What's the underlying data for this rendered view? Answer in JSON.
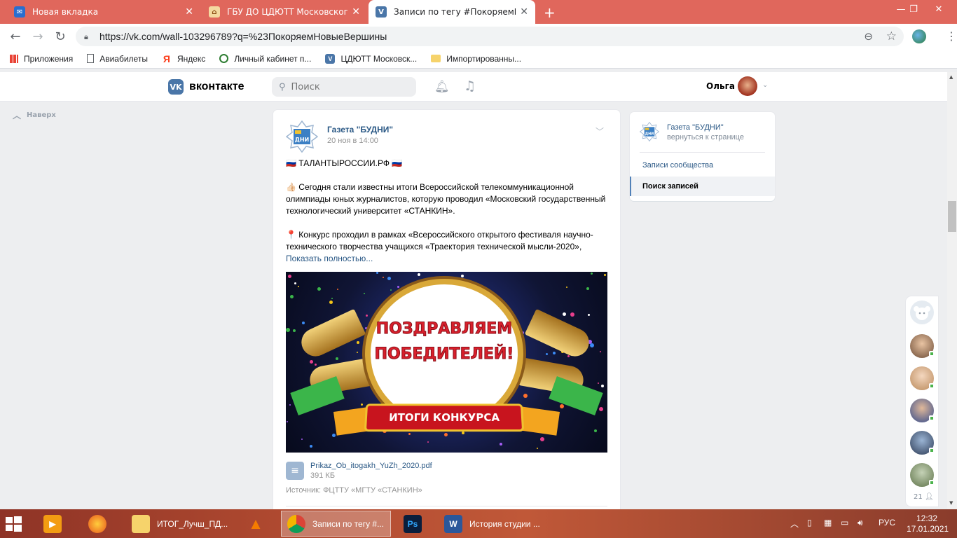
{
  "browser": {
    "tabs": [
      {
        "title": "Новая вкладка",
        "active": false
      },
      {
        "title": "ГБУ ДО ЦДЮТТ Московского р",
        "active": false
      },
      {
        "title": "Записи по тегу #ПокоряемНов",
        "active": true
      }
    ],
    "url": "https://vk.com/wall-103296789?q=%23ПокоряемНовыеВершины",
    "bookmarks": [
      {
        "label": "Приложения",
        "icon": "apps-grid-icon"
      },
      {
        "label": "Авиабилеты",
        "icon": "page-icon"
      },
      {
        "label": "Яндекс",
        "icon": "yandex-icon"
      },
      {
        "label": "Личный кабинет п...",
        "icon": "cabinet-icon"
      },
      {
        "label": "ЦДЮТТ Московск...",
        "icon": "vk-icon"
      },
      {
        "label": "Импортированны...",
        "icon": "folder-icon"
      }
    ]
  },
  "vk": {
    "logo_text": "вконтакте",
    "logo_letters": "VK",
    "search_placeholder": "Поиск",
    "user_name": "Ольга",
    "up_label": "Наверх"
  },
  "post": {
    "author": "Газета \"БУДНИ\"",
    "date": "20 ноя в 14:00",
    "paragraphs": [
      "🇷🇺 ТАЛАНТЫРОССИИ.РФ 🇷🇺",
      "👍🏻 Сегодня стали известны итоги Всероссийской телекоммуникационной олимпиады юных журналистов, которую проводил «Московский государственный технологический университет «СТАНКИН».",
      "📍 Конкурс проходил в рамках «Всероссийского открытого фестиваля научно-технического творчества учащихся «Траектория технической мысли-2020»,"
    ],
    "show_more": "Показать полностью...",
    "image_text_line1": "ПОЗДРАВЛЯЕМ",
    "image_text_line2": "ПОБЕДИТЕЛЕЙ!",
    "image_ribbon": "ИТОГИ КОНКУРСА",
    "doc_name": "Prikaz_Ob_itogakh_YuZh_2020.pdf",
    "doc_size": "391 КБ",
    "source": "Источник: ФЦТТУ «МГТУ «СТАНКИН»"
  },
  "sidebar": {
    "group_name": "Газета \"БУДНИ\"",
    "back_label": "вернуться к странице",
    "link_posts": "Записи сообщества",
    "link_search": "Поиск записей"
  },
  "friends": {
    "count": "21"
  },
  "taskbar": {
    "items": [
      {
        "label": "ИТОГ_Лучш_ПД...",
        "icon": "folder-icon"
      },
      {
        "label": "Записи по тегу #...",
        "icon": "chrome-icon"
      },
      {
        "label": "История студии ...",
        "icon": "word-icon"
      }
    ],
    "lang": "РУС",
    "time": "12:32",
    "date": "17.01.2021"
  },
  "colors": {
    "vk_blue": "#4a76a8",
    "vk_link": "#2a5885",
    "chrome_tabbar": "#e0675c",
    "online": "#4bb34b"
  }
}
